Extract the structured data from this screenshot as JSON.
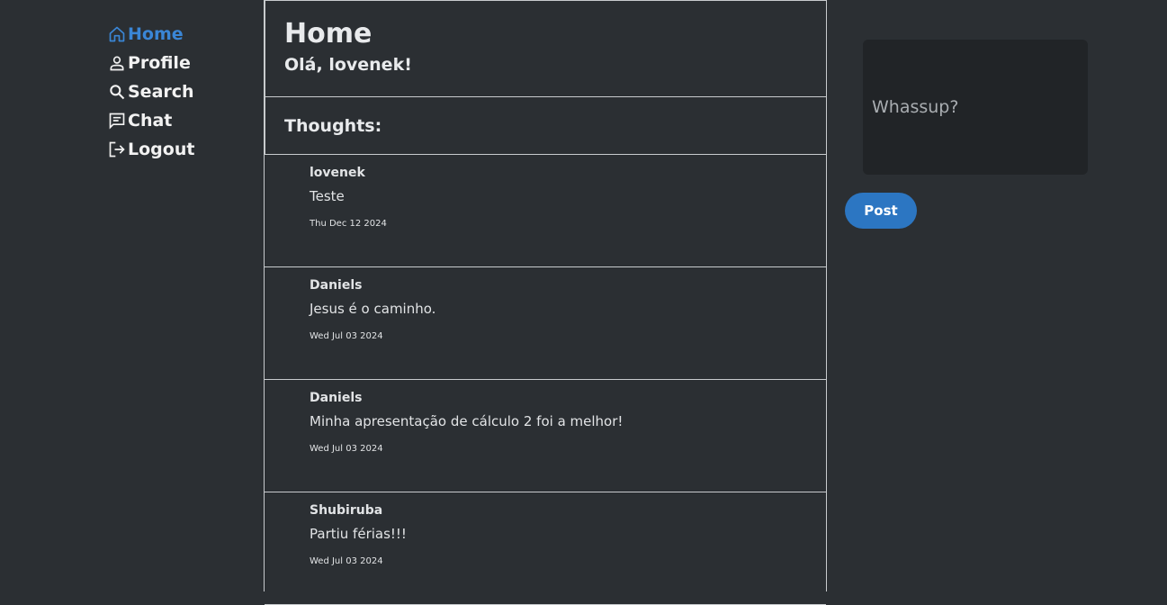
{
  "nav": {
    "items": [
      {
        "label": "Home",
        "icon": "home-icon",
        "active": true
      },
      {
        "label": "Profile",
        "icon": "user-icon",
        "active": false
      },
      {
        "label": "Search",
        "icon": "search-icon",
        "active": false
      },
      {
        "label": "Chat",
        "icon": "chat-icon",
        "active": false
      },
      {
        "label": "Logout",
        "icon": "logout-icon",
        "active": false
      }
    ]
  },
  "header": {
    "title": "Home",
    "greeting": "Olá, lovenek!"
  },
  "feed": {
    "heading": "Thoughts:",
    "posts": [
      {
        "author": "lovenek",
        "text": "Teste",
        "date": "Thu Dec 12 2024"
      },
      {
        "author": "Daniels",
        "text": "Jesus é o caminho.",
        "date": "Wed Jul 03 2024"
      },
      {
        "author": "Daniels",
        "text": "Minha apresentação de cálculo 2 foi a melhor!",
        "date": "Wed Jul 03 2024"
      },
      {
        "author": "Shubiruba",
        "text": "Partiu férias!!!",
        "date": "Wed Jul 03 2024"
      }
    ]
  },
  "compose": {
    "placeholder": "Whassup?",
    "button_label": "Post"
  },
  "colors": {
    "background": "#2b2f33",
    "accent": "#2c76c2",
    "active_nav": "#3a86d6",
    "compose_bg": "#212427"
  }
}
